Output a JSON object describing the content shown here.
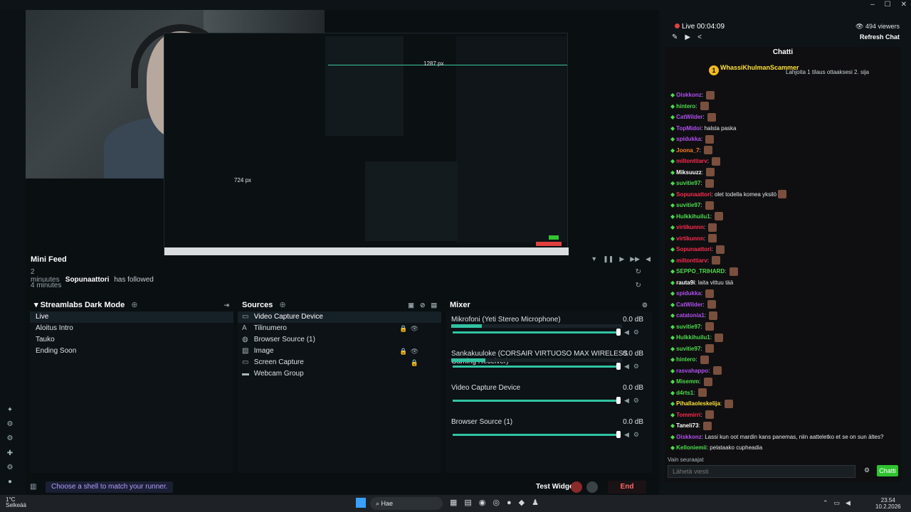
{
  "window": {
    "minimize": "–",
    "maximize": "☐",
    "close": "✕"
  },
  "preview": {
    "px_top": "1287 px",
    "px_left": "724 px"
  },
  "minifeed": {
    "title": "Mini Feed",
    "items": [
      {
        "time": "2 minuutes",
        "user": "Sopunaattori",
        "action": "has followed"
      },
      {
        "time": "4 minutes",
        "user": "",
        "action": ""
      }
    ]
  },
  "scenes": {
    "title": "Streamlabs Dark Mode",
    "items": [
      "Live",
      "Aloitus Intro",
      "Tauko",
      "Ending Soon"
    ]
  },
  "sources": {
    "title": "Sources",
    "items": [
      {
        "label": "Video Capture Device",
        "icon": "monitor-icon"
      },
      {
        "label": "Tilinumero",
        "icon": "text-icon"
      },
      {
        "label": "Browser Source (1)",
        "icon": "globe-icon"
      },
      {
        "label": "Image",
        "icon": "image-icon"
      },
      {
        "label": "Screen Capture",
        "icon": "screen-icon"
      },
      {
        "label": "Webcam Group",
        "icon": "folder-icon"
      }
    ]
  },
  "mixer": {
    "title": "Mixer",
    "items": [
      {
        "name": "Mikrofoni (Yeti Stereo Microphone)",
        "db": "0.0 dB",
        "level": 0.18
      },
      {
        "name": "Sankakuuloke (CORSAIR VIRTUOSO MAX WIRELESS Gaming Receiver)",
        "db": "0.0 dB",
        "level": 0.2
      },
      {
        "name": "Video Capture Device",
        "db": "0.0 dB",
        "level": 0
      },
      {
        "name": "Browser Source (1)",
        "db": "0.0 dB",
        "level": 0
      }
    ]
  },
  "footer": {
    "tip": "Choose a shell to match your runner.",
    "test_widgets": "Test Widgets",
    "end_stream": "End Stream"
  },
  "chat": {
    "live": "Live 00:04:09",
    "viewers": "494 viewers",
    "refresh": "Refresh Chat",
    "title": "Chatti",
    "pinned_user": "WhassiKhulmanScammer",
    "pinned_msg": "Lahjoita 1 tilaus ottaaksesi 2. sija",
    "messages": [
      {
        "user": "Oiskkonz",
        "text": "",
        "color": "#b14ff0",
        "emote": true
      },
      {
        "user": "hintero",
        "text": "",
        "color": "#4ddd4d",
        "emote": true
      },
      {
        "user": "CatWilder",
        "text": "",
        "color": "#b14ff0",
        "emote": true
      },
      {
        "user": "TopMidoi",
        "text": "halsta paska",
        "color": "#b14ff0",
        "emote": false
      },
      {
        "user": "spidukka",
        "text": "",
        "color": "#b14ff0",
        "emote": true
      },
      {
        "user": "Joona_7",
        "text": "",
        "color": "#ff7f24",
        "emote": true
      },
      {
        "user": "miltonttiarv",
        "text": "",
        "color": "#ff2b4f",
        "emote": true
      },
      {
        "user": "Miksuuzz",
        "text": "",
        "color": "#fff",
        "emote": true
      },
      {
        "user": "suvitie97",
        "text": "",
        "color": "#4ddd4d",
        "emote": true
      },
      {
        "user": "Sopunaattori",
        "text": "olet todella komea yksilö",
        "color": "#ff2b4f",
        "emote": true
      },
      {
        "user": "suvitie97",
        "text": "",
        "color": "#4ddd4d",
        "emote": true
      },
      {
        "user": "Hulkkihuilu1",
        "text": "",
        "color": "#4ddd4d",
        "emote": true
      },
      {
        "user": "virtikunnn",
        "text": "",
        "color": "#ff2b4f",
        "emote": true
      },
      {
        "user": "virtikunnn",
        "text": "",
        "color": "#ff2b4f",
        "emote": true
      },
      {
        "user": "Sopunaattori",
        "text": "",
        "color": "#ff2b4f",
        "emote": true
      },
      {
        "user": "miltonttiarv",
        "text": "",
        "color": "#ff2b4f",
        "emote": true
      },
      {
        "user": "SEPPO_TRIHARD",
        "text": "",
        "color": "#4ddd4d",
        "emote": true
      },
      {
        "user": "rauta9i",
        "text": "laita vittuu tää",
        "color": "#fff",
        "emote": false
      },
      {
        "user": "spidukka",
        "text": "",
        "color": "#b14ff0",
        "emote": true
      },
      {
        "user": "CatWilder",
        "text": "",
        "color": "#b14ff0",
        "emote": true
      },
      {
        "user": "catatonia1",
        "text": "",
        "color": "#b14ff0",
        "emote": true
      },
      {
        "user": "suvitie97",
        "text": "",
        "color": "#4ddd4d",
        "emote": true
      },
      {
        "user": "Hulkkihuilu1",
        "text": "",
        "color": "#4ddd4d",
        "emote": true
      },
      {
        "user": "suvitie97",
        "text": "",
        "color": "#4ddd4d",
        "emote": true
      },
      {
        "user": "hintero",
        "text": "",
        "color": "#4ddd4d",
        "emote": true
      },
      {
        "user": "rasvahappo",
        "text": "",
        "color": "#b14ff0",
        "emote": true
      },
      {
        "user": "Misemm",
        "text": "",
        "color": "#4ddd4d",
        "emote": true
      },
      {
        "user": "d4rts1",
        "text": "",
        "color": "#4ddd4d",
        "emote": true
      },
      {
        "user": "Pihallaoleskelija",
        "text": "",
        "color": "#ffe23a",
        "emote": true
      },
      {
        "user": "Tommirri",
        "text": "",
        "color": "#ff2b4f",
        "emote": true
      },
      {
        "user": "Taneli73",
        "text": "",
        "color": "#fff",
        "emote": true
      },
      {
        "user": "Oiskkonz",
        "text": "Lassi kun oot mardin kans panemas, niin aatteletko et se on sun ältes?",
        "color": "#b14ff0",
        "emote": false
      },
      {
        "user": "Kelloniemii",
        "text": "pelataako cupheadia",
        "color": "#4ddd4d",
        "emote": false
      }
    ],
    "followers_only": "Vain seuraajat",
    "input_placeholder": "Lähetä viesti",
    "send": "Chatti"
  },
  "taskbar": {
    "weather_temp": "1°C",
    "weather_desc": "Selkeää",
    "search": "Hae",
    "time": "23.54",
    "date": "10.2.2026"
  }
}
